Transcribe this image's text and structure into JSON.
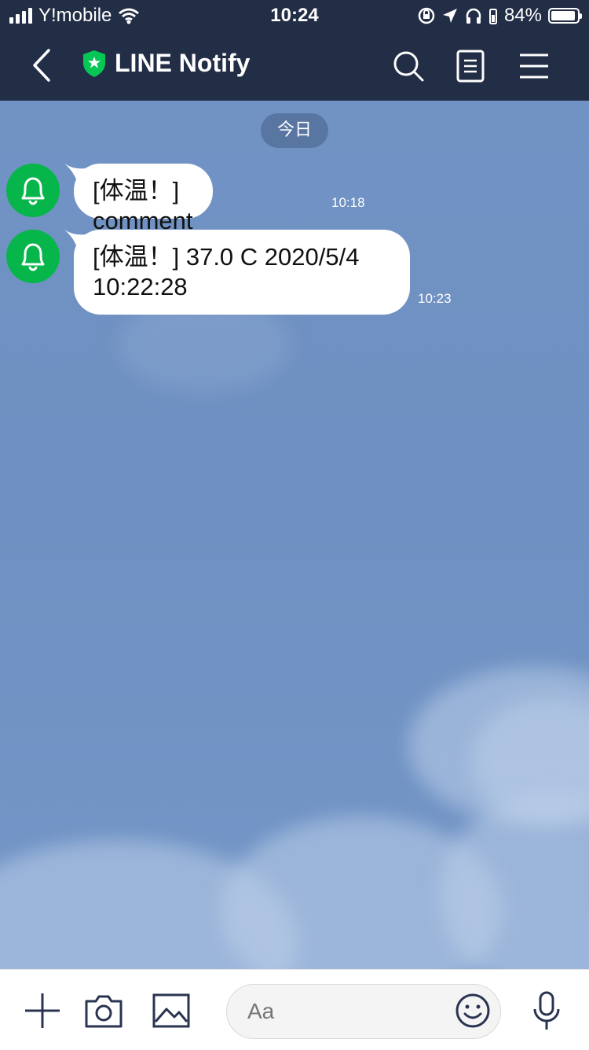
{
  "status_bar": {
    "carrier": "Y!mobile",
    "time": "10:24",
    "battery": "84%",
    "battery_level": 0.84
  },
  "nav": {
    "title": "LINE Notify",
    "back_icon": "chevron-left-icon",
    "search_icon": "search-icon",
    "notes_icon": "notes-icon",
    "menu_icon": "hamburger-menu-icon"
  },
  "chat": {
    "date_separator": "今日",
    "messages": [
      {
        "text_line1": "[体温！] comment",
        "text_line2": "",
        "time": "10:18"
      },
      {
        "text_line1": "[体温！] 37.0 C 2020/5/4",
        "text_line2": "10:22:28",
        "time": "10:23"
      }
    ]
  },
  "input_bar": {
    "placeholder": "Aa",
    "value": ""
  },
  "colors": {
    "header_bg": "#222d46",
    "chat_bg": "#7193c4",
    "avatar_green": "#06b64a",
    "bubble_bg": "#ffffff"
  }
}
